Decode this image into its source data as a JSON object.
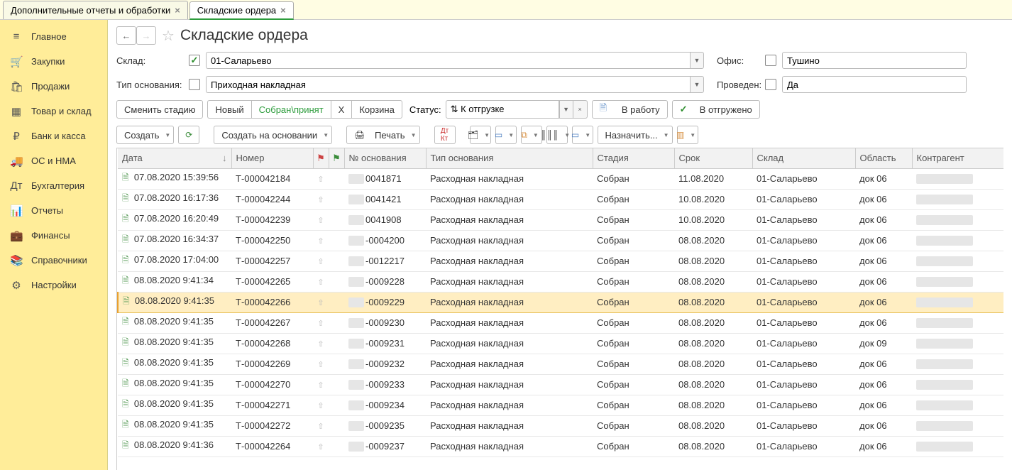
{
  "tabs": [
    {
      "label": "Дополнительные отчеты и обработки",
      "active": false
    },
    {
      "label": "Складские ордера",
      "active": true
    }
  ],
  "sidebar": [
    {
      "icon": "≡",
      "label": "Главное"
    },
    {
      "icon": "🛒",
      "label": "Закупки"
    },
    {
      "icon": "🛍",
      "label": "Продажи"
    },
    {
      "icon": "▦",
      "label": "Товар и склад"
    },
    {
      "icon": "₽",
      "label": "Банк и касса"
    },
    {
      "icon": "🚚",
      "label": "ОС и НМА"
    },
    {
      "icon": "Дт",
      "label": "Бухгалтерия"
    },
    {
      "icon": "📊",
      "label": "Отчеты"
    },
    {
      "icon": "💼",
      "label": "Финансы"
    },
    {
      "icon": "📚",
      "label": "Справочники"
    },
    {
      "icon": "⚙",
      "label": "Настройки"
    }
  ],
  "title": "Складские ордера",
  "filters": {
    "warehouse_label": "Склад:",
    "warehouse_checked": true,
    "warehouse_value": "01-Саларьево",
    "office_label": "Офис:",
    "office_checked": false,
    "office_value": "Тушино",
    "basis_label": "Тип основания:",
    "basis_checked": false,
    "basis_value": "Приходная накладная",
    "posted_label": "Проведен:",
    "posted_checked": false,
    "posted_value": "Да"
  },
  "toolbar1": {
    "change_stage": "Сменить стадию",
    "new": "Новый",
    "assembled": "Собран\\принят",
    "x": "Х",
    "trash": "Корзина",
    "status_label": "Статус:",
    "status_value": "⇅ К отгрузке",
    "in_work": "В работу",
    "shipped": "В отгружено"
  },
  "toolbar2": {
    "create": "Создать",
    "create_on_basis": "Создать на основании",
    "print": "Печать",
    "assign": "Назначить..."
  },
  "columns": [
    "Дата",
    "Номер",
    "",
    "",
    "№ основания",
    "Тип основания",
    "Стадия",
    "Срок",
    "Склад",
    "Область",
    "Контрагент"
  ],
  "rows": [
    {
      "date": "07.08.2020 15:39:56",
      "num": "Т-000042184",
      "basis": "0041871",
      "type": "Расходная накладная",
      "stage": "Собран",
      "due": "11.08.2020",
      "wh": "01-Саларьево",
      "area": "док 06",
      "selected": false
    },
    {
      "date": "07.08.2020 16:17:36",
      "num": "Т-000042244",
      "basis": "0041421",
      "type": "Расходная накладная",
      "stage": "Собран",
      "due": "10.08.2020",
      "wh": "01-Саларьево",
      "area": "док 06",
      "selected": false
    },
    {
      "date": "07.08.2020 16:20:49",
      "num": "Т-000042239",
      "basis": "0041908",
      "type": "Расходная накладная",
      "stage": "Собран",
      "due": "10.08.2020",
      "wh": "01-Саларьево",
      "area": "док 06",
      "selected": false
    },
    {
      "date": "07.08.2020 16:34:37",
      "num": "Т-000042250",
      "basis": "-0004200",
      "type": "Расходная накладная",
      "stage": "Собран",
      "due": "08.08.2020",
      "wh": "01-Саларьево",
      "area": "док 06",
      "selected": false
    },
    {
      "date": "07.08.2020 17:04:00",
      "num": "Т-000042257",
      "basis": "-0012217",
      "type": "Расходная накладная",
      "stage": "Собран",
      "due": "08.08.2020",
      "wh": "01-Саларьево",
      "area": "док 06",
      "selected": false
    },
    {
      "date": "08.08.2020 9:41:34",
      "num": "Т-000042265",
      "basis": "-0009228",
      "type": "Расходная накладная",
      "stage": "Собран",
      "due": "08.08.2020",
      "wh": "01-Саларьево",
      "area": "док 06",
      "selected": false
    },
    {
      "date": "08.08.2020 9:41:35",
      "num": "Т-000042266",
      "basis": "-0009229",
      "type": "Расходная накладная",
      "stage": "Собран",
      "due": "08.08.2020",
      "wh": "01-Саларьево",
      "area": "док 06",
      "selected": true
    },
    {
      "date": "08.08.2020 9:41:35",
      "num": "Т-000042267",
      "basis": "-0009230",
      "type": "Расходная накладная",
      "stage": "Собран",
      "due": "08.08.2020",
      "wh": "01-Саларьево",
      "area": "док 06",
      "selected": false
    },
    {
      "date": "08.08.2020 9:41:35",
      "num": "Т-000042268",
      "basis": "-0009231",
      "type": "Расходная накладная",
      "stage": "Собран",
      "due": "08.08.2020",
      "wh": "01-Саларьево",
      "area": "док 09",
      "selected": false
    },
    {
      "date": "08.08.2020 9:41:35",
      "num": "Т-000042269",
      "basis": "-0009232",
      "type": "Расходная накладная",
      "stage": "Собран",
      "due": "08.08.2020",
      "wh": "01-Саларьево",
      "area": "док 06",
      "selected": false
    },
    {
      "date": "08.08.2020 9:41:35",
      "num": "Т-000042270",
      "basis": "-0009233",
      "type": "Расходная накладная",
      "stage": "Собран",
      "due": "08.08.2020",
      "wh": "01-Саларьево",
      "area": "док 06",
      "selected": false
    },
    {
      "date": "08.08.2020 9:41:35",
      "num": "Т-000042271",
      "basis": "-0009234",
      "type": "Расходная накладная",
      "stage": "Собран",
      "due": "08.08.2020",
      "wh": "01-Саларьево",
      "area": "док 06",
      "selected": false
    },
    {
      "date": "08.08.2020 9:41:35",
      "num": "Т-000042272",
      "basis": "-0009235",
      "type": "Расходная накладная",
      "stage": "Собран",
      "due": "08.08.2020",
      "wh": "01-Саларьево",
      "area": "док 06",
      "selected": false
    },
    {
      "date": "08.08.2020 9:41:36",
      "num": "Т-000042264",
      "basis": "-0009237",
      "type": "Расходная накладная",
      "stage": "Собран",
      "due": "08.08.2020",
      "wh": "01-Саларьево",
      "area": "док 06",
      "selected": false
    }
  ]
}
